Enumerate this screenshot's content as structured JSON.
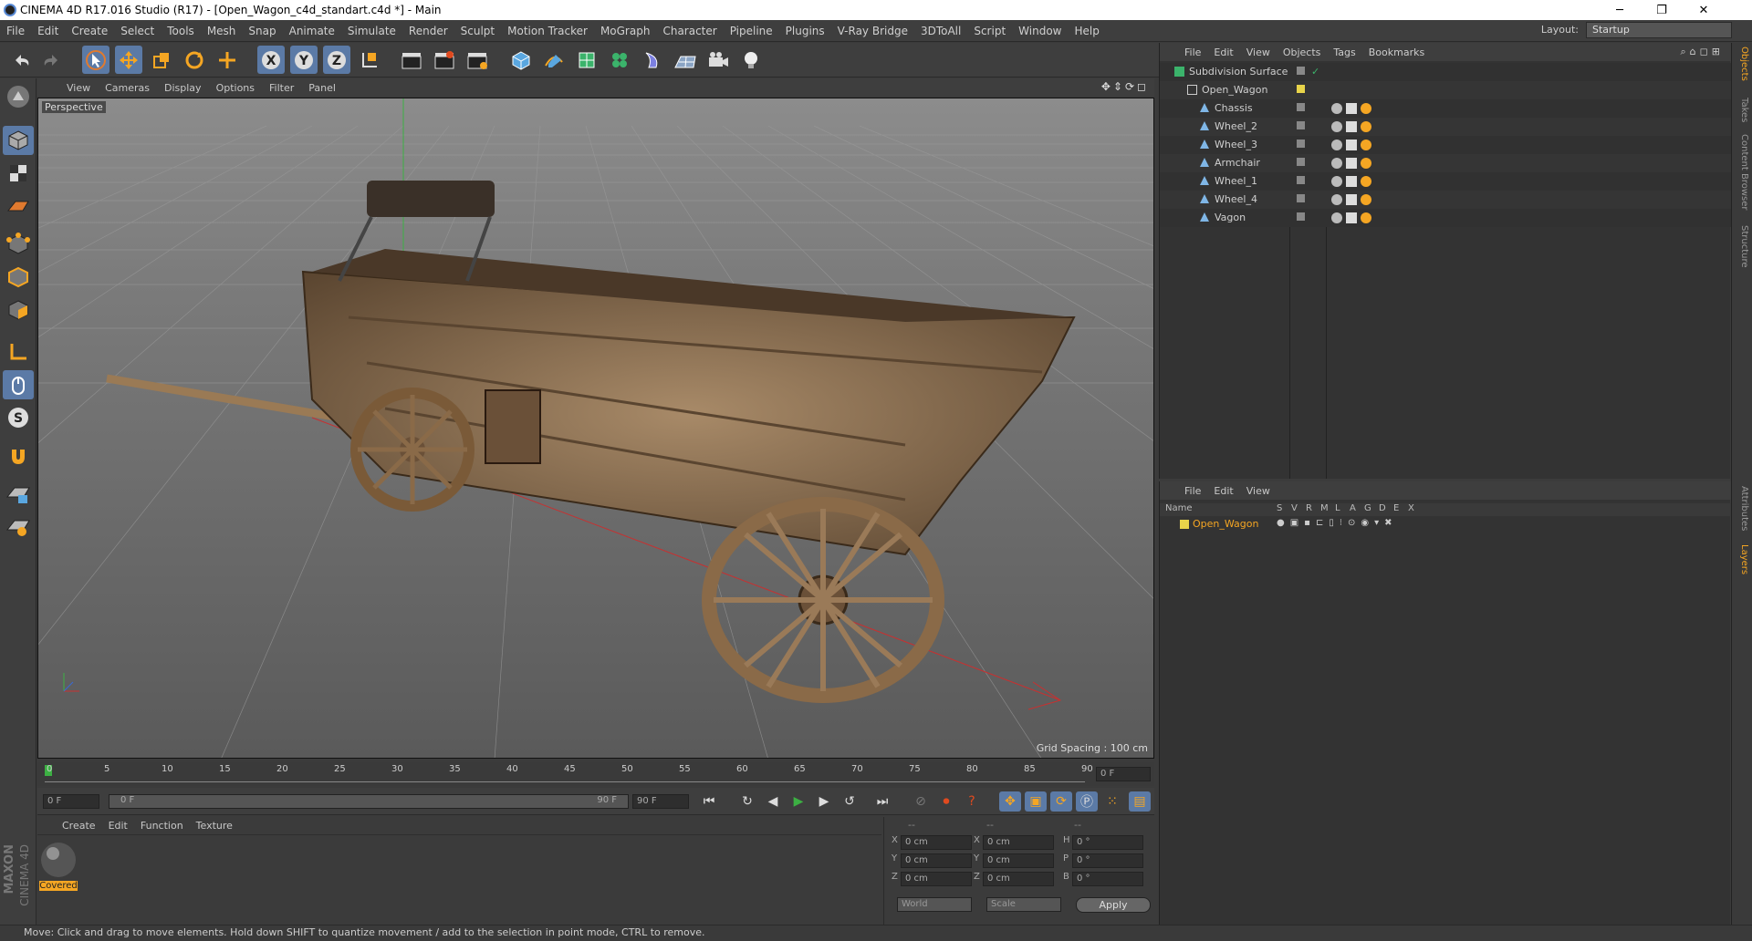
{
  "window": {
    "title": "CINEMA 4D R17.016 Studio (R17) - [Open_Wagon_c4d_standart.c4d *] - Main",
    "min": "─",
    "max": "❐",
    "close": "✕"
  },
  "menu": [
    "File",
    "Edit",
    "Create",
    "Select",
    "Tools",
    "Mesh",
    "Snap",
    "Animate",
    "Simulate",
    "Render",
    "Sculpt",
    "Motion Tracker",
    "MoGraph",
    "Character",
    "Pipeline",
    "Plugins",
    "V-Ray Bridge",
    "3DToAll",
    "Script",
    "Window",
    "Help"
  ],
  "layout": {
    "label": "Layout:",
    "value": "Startup"
  },
  "viewport": {
    "menu": [
      "View",
      "Cameras",
      "Display",
      "Options",
      "Filter",
      "Panel"
    ],
    "label": "Perspective",
    "grid": "Grid Spacing : 100 cm"
  },
  "timeline": {
    "ticks": [
      "0",
      "5",
      "10",
      "15",
      "20",
      "25",
      "30",
      "35",
      "40",
      "45",
      "50",
      "55",
      "60",
      "65",
      "70",
      "75",
      "80",
      "85",
      "90"
    ],
    "frame_field": "0 F",
    "start": "0 F",
    "range_start": "0 F",
    "range_end": "90 F",
    "end": "90 F"
  },
  "material": {
    "menu": [
      "Create",
      "Edit",
      "Function",
      "Texture"
    ],
    "name": "Covered"
  },
  "coords": {
    "headers": [
      "--",
      "--",
      "--"
    ],
    "rows": [
      {
        "a": "X",
        "av": "0 cm",
        "b": "X",
        "bv": "0 cm",
        "c": "H",
        "cv": "0 °"
      },
      {
        "a": "Y",
        "av": "0 cm",
        "b": "Y",
        "bv": "0 cm",
        "c": "P",
        "cv": "0 °"
      },
      {
        "a": "Z",
        "av": "0 cm",
        "b": "Z",
        "bv": "0 cm",
        "c": "B",
        "cv": "0 °"
      }
    ],
    "world": "World",
    "scale": "Scale",
    "apply": "Apply"
  },
  "status": "Move: Click and drag to move elements. Hold down SHIFT to quantize movement / add to the selection in point mode, CTRL to remove.",
  "objects": {
    "menu": [
      "File",
      "Edit",
      "View",
      "Objects",
      "Tags",
      "Bookmarks"
    ],
    "items": [
      {
        "name": "Subdivision Surface",
        "indent": 0
      },
      {
        "name": "Open_Wagon",
        "indent": 1
      },
      {
        "name": "Chassis",
        "indent": 2
      },
      {
        "name": "Wheel_2",
        "indent": 2
      },
      {
        "name": "Wheel_3",
        "indent": 2
      },
      {
        "name": "Armchair",
        "indent": 2
      },
      {
        "name": "Wheel_1",
        "indent": 2
      },
      {
        "name": "Wheel_4",
        "indent": 2
      },
      {
        "name": "Vagon",
        "indent": 2
      }
    ]
  },
  "layers": {
    "menu": [
      "File",
      "Edit",
      "View"
    ],
    "headers": [
      "Name",
      "S",
      "V",
      "R",
      "M",
      "L",
      "A",
      "G",
      "D",
      "E",
      "X"
    ],
    "item": "Open_Wagon"
  },
  "right_tabs": [
    "Objects",
    "Takes",
    "Content Browser",
    "Structure",
    "Attributes",
    "Layers"
  ],
  "brand": {
    "maxon": "MAXON",
    "c4d": "CINEMA 4D"
  },
  "colors": {
    "accent": "#f5a623",
    "selected": "#5b7aa6",
    "yellow": "#e8d44a"
  }
}
